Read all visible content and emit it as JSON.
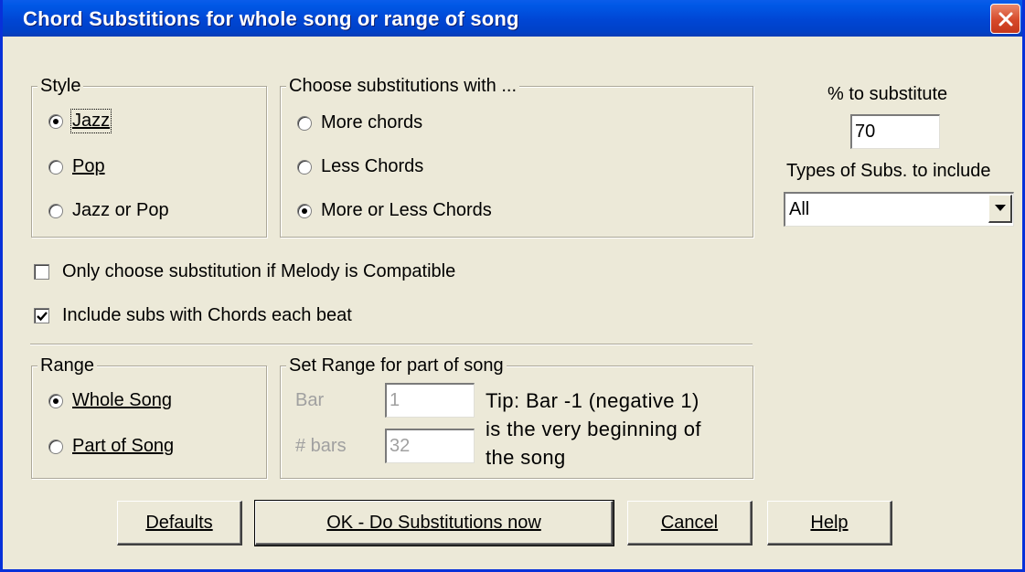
{
  "window": {
    "title": "Chord Substitions for whole song or range of song",
    "close_glyph": "close-icon"
  },
  "style_group": {
    "legend": "Style",
    "options": [
      {
        "label": "Jazz",
        "checked": true
      },
      {
        "label": "Pop",
        "checked": false
      },
      {
        "label": "Jazz or Pop",
        "checked": false
      }
    ]
  },
  "choose_group": {
    "legend": "Choose substitutions with ...",
    "options": [
      {
        "label": "More chords",
        "checked": false
      },
      {
        "label": "Less Chords",
        "checked": false
      },
      {
        "label": "More or Less Chords",
        "checked": true
      }
    ]
  },
  "percent": {
    "label": "% to substitute",
    "value": "70"
  },
  "types": {
    "label": "Types of Subs. to include",
    "selected": "All"
  },
  "checkboxes": [
    {
      "label": "Only choose substitution if Melody is Compatible",
      "checked": false
    },
    {
      "label": "Include subs with Chords each beat",
      "checked": true
    }
  ],
  "range_group": {
    "legend": "Range",
    "options": [
      {
        "label": "Whole Song",
        "checked": true
      },
      {
        "label": "Part of Song",
        "checked": false
      }
    ]
  },
  "set_range_group": {
    "legend": "Set Range for part of song",
    "bar_label": "Bar",
    "bar_value": "1",
    "bars_label": "# bars",
    "bars_value": "32",
    "tip_lines": [
      "Tip: Bar -1 (negative 1)",
      "is the very beginning of",
      "the song"
    ]
  },
  "buttons": {
    "defaults": "Defaults",
    "ok": "OK - Do Substitutions now",
    "cancel": "Cancel",
    "help": "Help"
  },
  "colors": {
    "titlebar": "#0054E3",
    "face": "#ECE9D8",
    "close": "#D6492A"
  }
}
